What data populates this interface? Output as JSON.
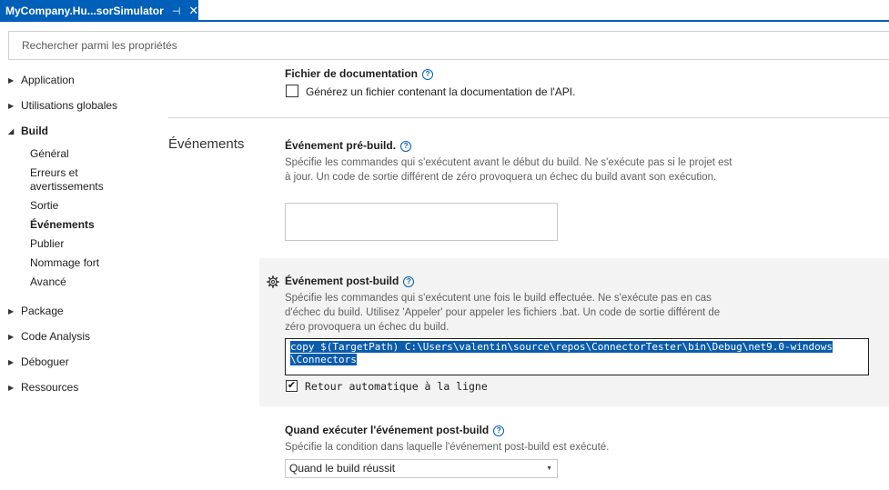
{
  "tab": {
    "title": "MyCompany.Hu...sorSimulator",
    "pin": "⊣",
    "close": "✕"
  },
  "search": {
    "placeholder": "Rechercher parmi les propriétés"
  },
  "sidebar": {
    "items": [
      {
        "label": "Application",
        "arrow": "▶"
      },
      {
        "label": "Utilisations globales",
        "arrow": "▶"
      },
      {
        "label": "Build",
        "arrow": "◢"
      },
      {
        "label": "Package",
        "arrow": "▶"
      },
      {
        "label": "Code Analysis",
        "arrow": "▶"
      },
      {
        "label": "Déboguer",
        "arrow": "▶"
      },
      {
        "label": "Ressources",
        "arrow": "▶"
      }
    ],
    "build_children": [
      "Général",
      "Erreurs et avertissements",
      "Sortie",
      "Événements",
      "Publier",
      "Nommage fort",
      "Avancé"
    ]
  },
  "doc": {
    "label": "Fichier de documentation",
    "checkbox_label": "Générez un fichier contenant la documentation de l'API.",
    "checked": false
  },
  "section": {
    "title": "Événements"
  },
  "prebuild": {
    "label": "Événement pré-build.",
    "description": "Spécifie les commandes qui s'exécutent avant le début du build. Ne s'exécute pas si le projet est à jour. Un code de sortie différent de zéro provoquera un échec du build avant son exécution.",
    "value": ""
  },
  "postbuild": {
    "label": "Événement post-build",
    "description": "Spécifie les commandes qui s'exécutent une fois le build effectuée. Ne s'exécute pas en cas d'échec du build. Utilisez 'Appeler' pour appeler les fichiers .bat. Un code de sortie différent de zéro provoquera un échec du build.",
    "line1": "copy $(TargetPath) C:\\Users\\valentin\\source\\repos\\ConnectorTester\\bin\\Debug\\net9.0-windows",
    "line2": "\\Connectors",
    "wrap_label": "Retour automatique à la ligne",
    "wrap_checked": true
  },
  "when": {
    "label": "Quand exécuter l'événement post-build",
    "description": "Spécifie la condition dans laquelle l'événement post-build est exécuté.",
    "selected": "Quand le build réussit"
  },
  "help_glyph": "?",
  "check_glyph": "✔",
  "caret_glyph": "▼"
}
